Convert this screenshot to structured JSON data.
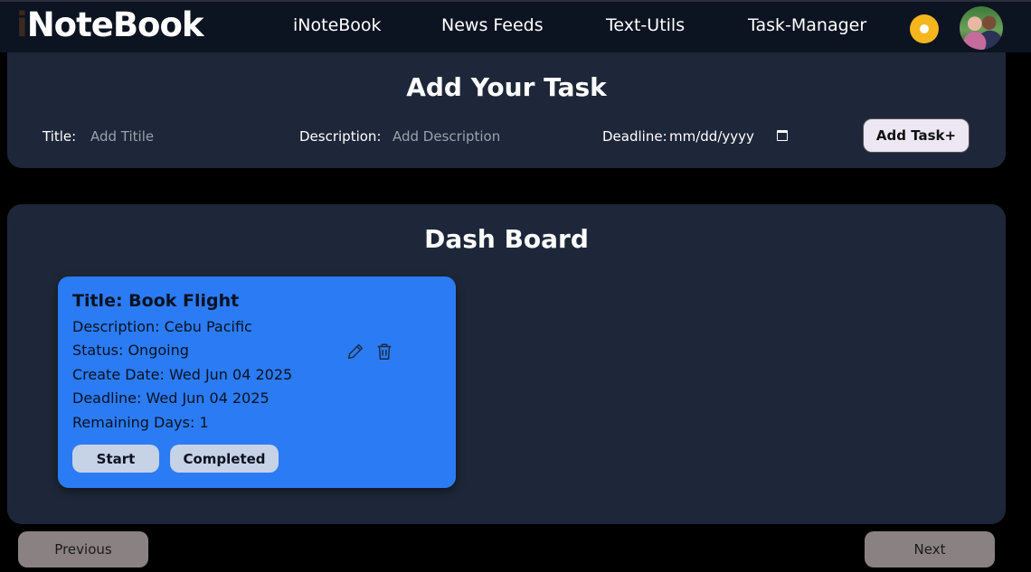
{
  "navbar": {
    "brand": "NoteBook",
    "brand_first": "i",
    "links": [
      "iNoteBook",
      "News Feeds",
      "Text-Utils",
      "Task-Manager"
    ]
  },
  "add_task": {
    "heading": "Add Your Task",
    "title_label": "Title:",
    "title_placeholder": "Add Titile",
    "description_label": "Description:",
    "description_placeholder": "Add Description",
    "deadline_label": "Deadline:",
    "deadline_value": "mm/dd/yyyy",
    "add_button": "Add Task+"
  },
  "dashboard": {
    "heading": "Dash Board",
    "tasks": [
      {
        "title": "Title: Book Flight",
        "description": "Description: Cebu Pacific",
        "status": "Status: Ongoing",
        "create_date": "Create Date: Wed Jun 04 2025",
        "deadline": "Deadline: Wed Jun 04 2025",
        "remaining": "Remaining Days: 1",
        "start_button": "Start",
        "completed_button": "Completed"
      }
    ]
  },
  "pagination": {
    "previous": "Previous",
    "next": "Next"
  },
  "colors": {
    "navbar_bg": "#0c1321",
    "panel_bg": "#1e2739",
    "card_bg": "#2b7bf5",
    "theme_toggle": "#f5b51d",
    "page_button": "#8a8282"
  },
  "icons": [
    "sun-icon",
    "edit-icon",
    "trash-icon",
    "calendar-icon"
  ]
}
